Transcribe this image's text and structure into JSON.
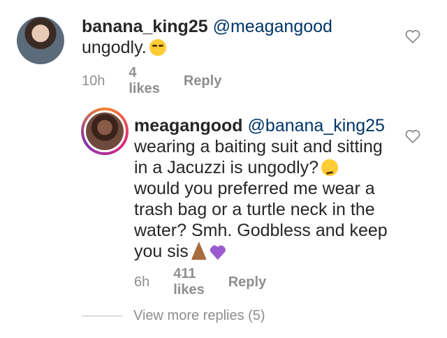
{
  "comments": [
    {
      "username": "banana_king25",
      "mention": "@meagangood",
      "text": "ungodly.",
      "emoji": "unamused-face-emoji",
      "time": "10h",
      "likes": "4 likes",
      "reply_label": "Reply"
    },
    {
      "username": "meagangood",
      "mention": "@banana_king25",
      "text_lines": [
        "wearing a baiting suit and sitting",
        "in a Jacuzzi is ungodly?",
        "would you preferred me wear a",
        "trash bag or a turtle neck in the",
        "water? Smh. Godbless and keep",
        "you sis"
      ],
      "emojis": [
        "thinking-face-emoji",
        "folded-hands-emoji",
        "purple-heart-emoji"
      ],
      "time": "6h",
      "likes": "411 likes",
      "reply_label": "Reply"
    }
  ],
  "view_more": "View more replies (5)",
  "colors": {
    "username": "#262626",
    "mention": "#003569",
    "meta": "#8e8e8e"
  }
}
